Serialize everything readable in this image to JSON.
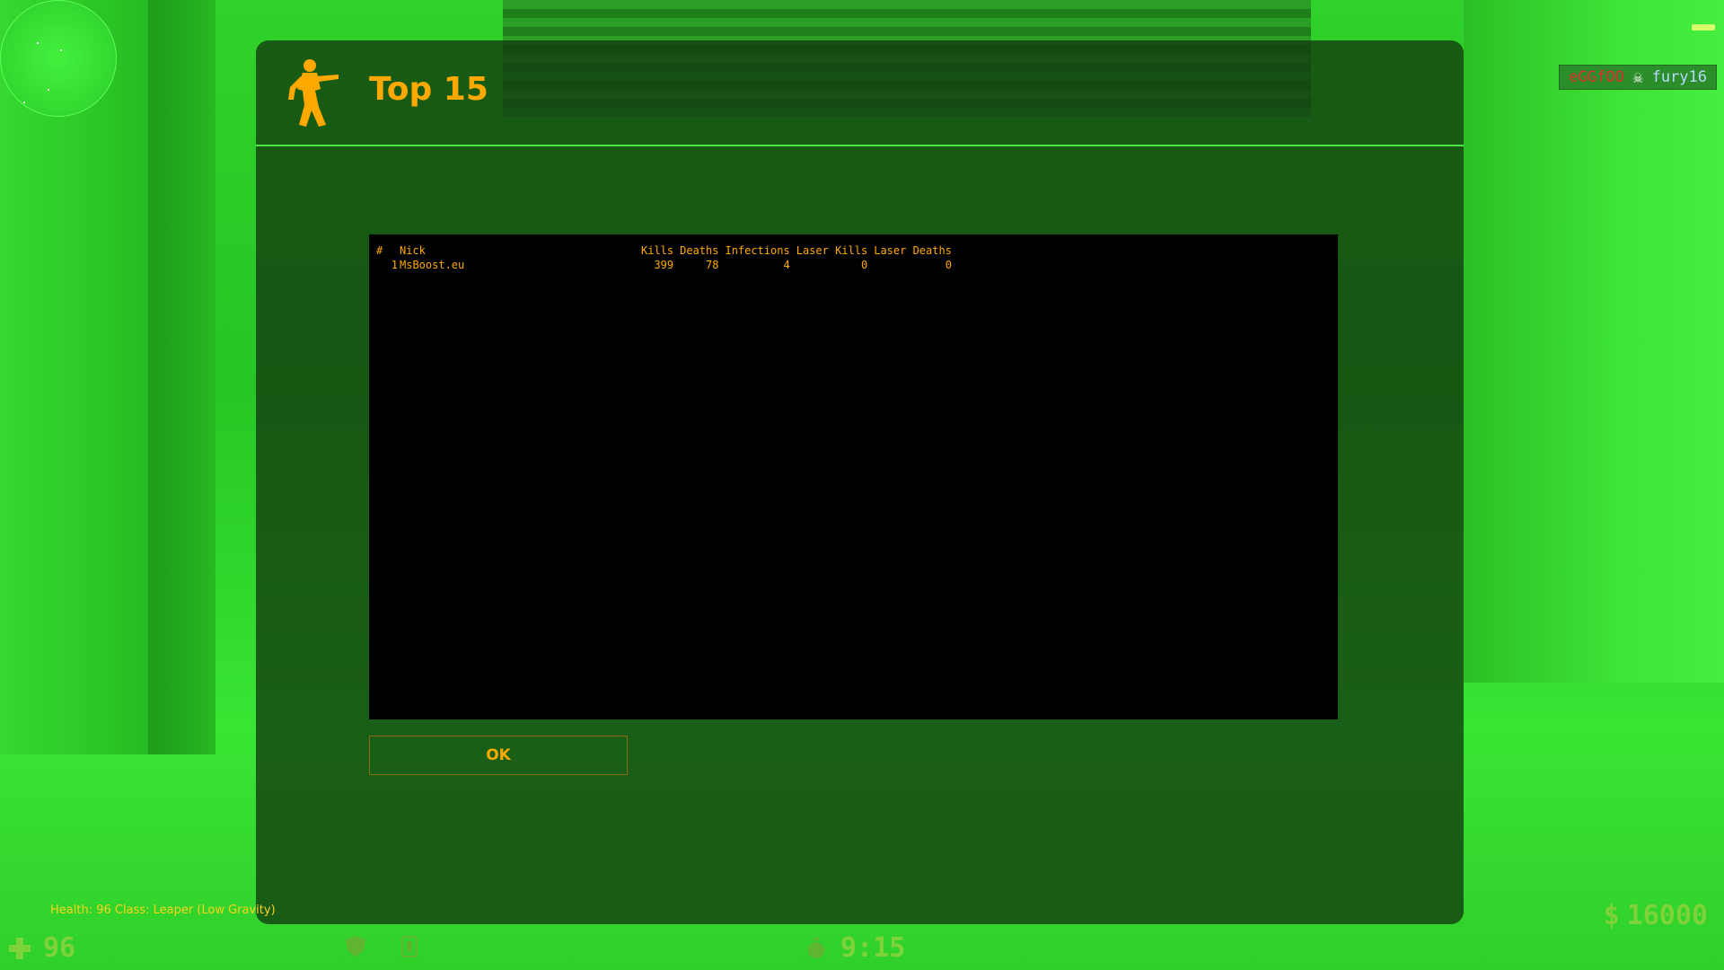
{
  "killfeed": {
    "attacker": "eGGfOO",
    "victim": "fury16",
    "icon": "skull-icon"
  },
  "motd": {
    "title": "Top 15",
    "logo_icon": "counter-terrorist-icon",
    "ok_label": "OK",
    "table": {
      "headers": {
        "rank": "#",
        "nick": "Nick",
        "kills": "Kills",
        "deaths": "Deaths",
        "infections": "Infections",
        "laser_kills": "Laser Kills",
        "laser_deaths": "Laser Deaths"
      },
      "rows": [
        {
          "rank": "1",
          "nick": "MsBoost.eu",
          "kills": "399",
          "deaths": "78",
          "infections": "4",
          "laser_kills": "0",
          "laser_deaths": "0"
        }
      ]
    }
  },
  "hud": {
    "info_text": "Health: 96  Class: Leaper (Low Gravity)",
    "health_icon": "cross-icon",
    "health_value": "96",
    "armor_icon": "shield-icon",
    "kevlar_icon": "vest-icon",
    "timer_icon": "stopwatch-icon",
    "timer_value": "9:15",
    "money_symbol": "$",
    "money_value": "16000"
  },
  "colors": {
    "accent": "#ffa800",
    "hud_green": "#7ed23a",
    "divider": "#4ce643"
  }
}
